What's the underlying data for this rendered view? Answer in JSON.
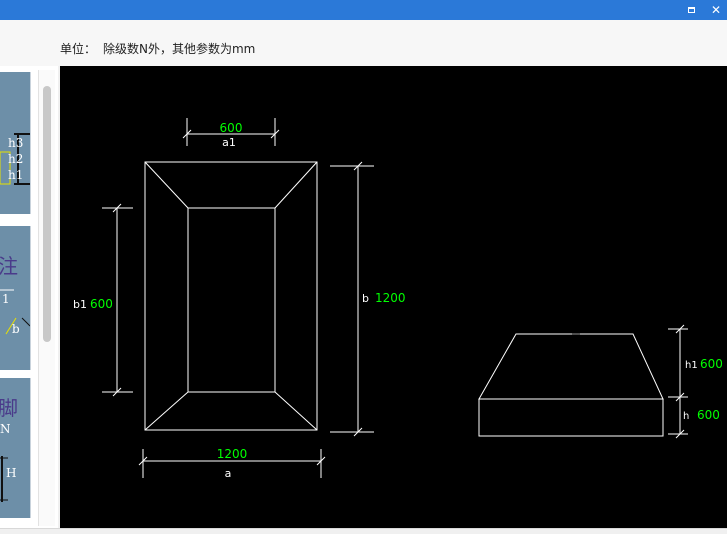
{
  "window": {
    "maximize_icon": "maximize-icon",
    "close_glyph": "✕"
  },
  "units": {
    "label": "单位：",
    "text": "除级数N外，其他参数为mm"
  },
  "thumbnails": {
    "t1": {
      "h3": "h3",
      "h2": "h2",
      "h1": "h1"
    },
    "t2": {
      "char": "注",
      "l1": "1",
      "b": "b"
    },
    "t3": {
      "char": "脚",
      "n": "N",
      "h": "H"
    }
  },
  "drawing": {
    "a1": {
      "label": "a1",
      "value": "600"
    },
    "b1": {
      "label": "b1",
      "value": "600"
    },
    "b": {
      "label": "b",
      "value": "1200"
    },
    "a": {
      "label": "a",
      "value": "1200"
    },
    "h1": {
      "label": "h1",
      "value": "600"
    },
    "h": {
      "label": "h",
      "value": "600"
    },
    "value_color": "#00ff00",
    "line_color": "#ffffff"
  }
}
